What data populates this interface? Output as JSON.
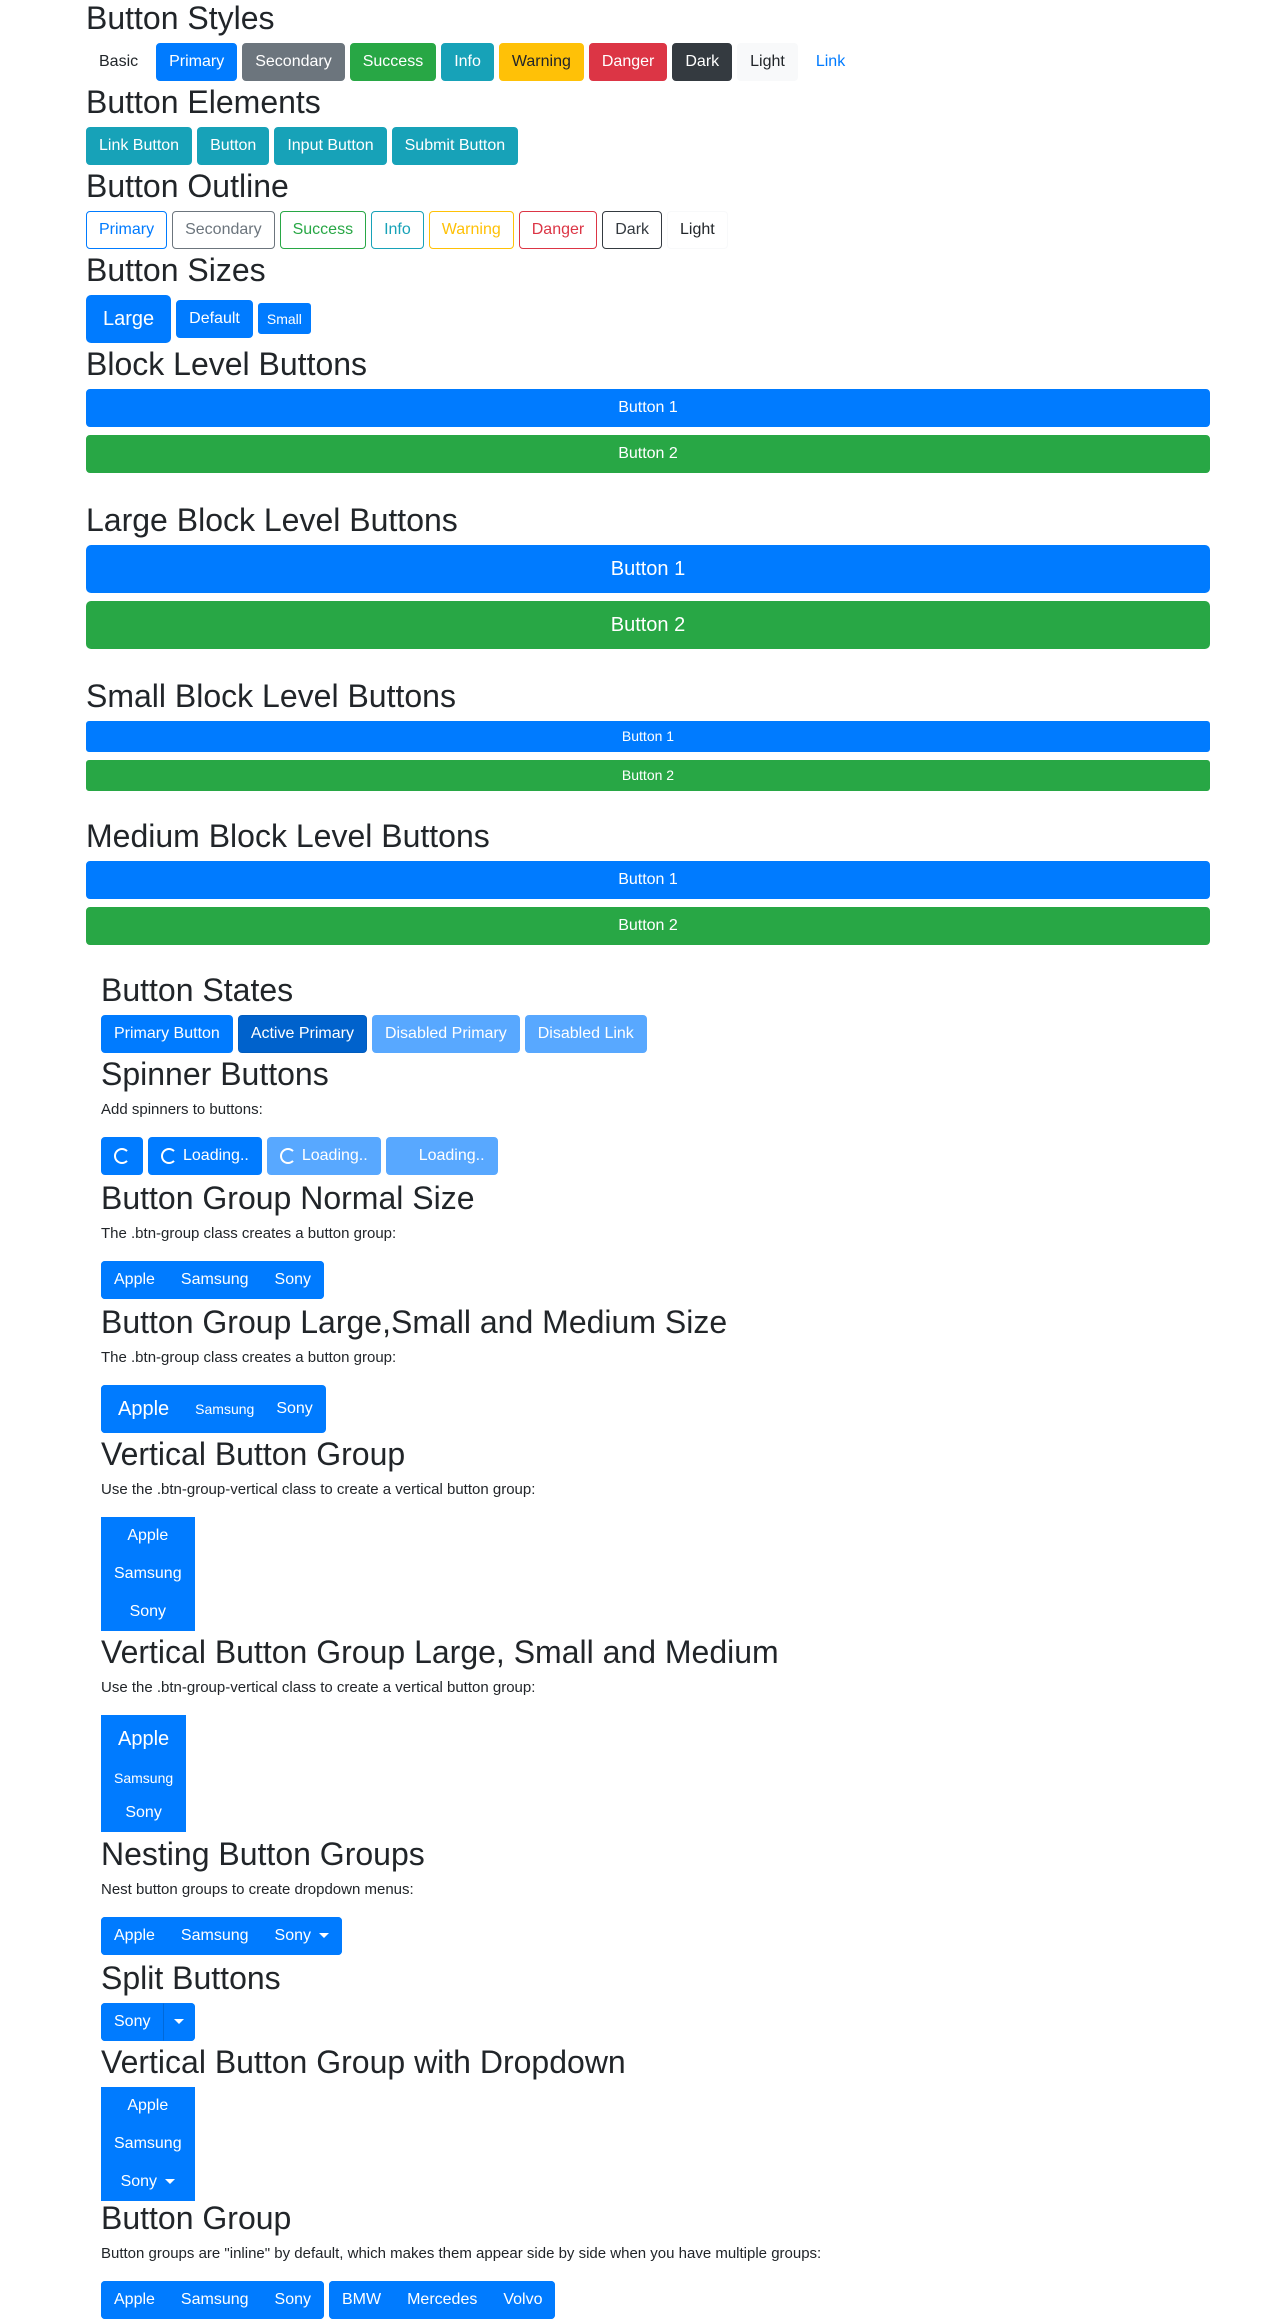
{
  "sections": {
    "styles": {
      "title": "Button Styles",
      "buttons": [
        "Basic",
        "Primary",
        "Secondary",
        "Success",
        "Info",
        "Warning",
        "Danger",
        "Dark",
        "Light",
        "Link"
      ]
    },
    "elements": {
      "title": "Button Elements",
      "buttons": [
        "Link Button",
        "Button",
        "Input Button",
        "Submit Button"
      ]
    },
    "outline": {
      "title": "Button Outline",
      "buttons": [
        "Primary",
        "Secondary",
        "Success",
        "Info",
        "Warning",
        "Danger",
        "Dark",
        "Light"
      ]
    },
    "sizes": {
      "title": "Button Sizes",
      "buttons": [
        "Large",
        "Default",
        "Small"
      ]
    },
    "block": {
      "title": "Block Level Buttons",
      "buttons": [
        "Button 1",
        "Button 2"
      ]
    },
    "block_large": {
      "title": "Large Block Level Buttons",
      "buttons": [
        "Button 1",
        "Button 2"
      ]
    },
    "block_small": {
      "title": "Small Block Level Buttons",
      "buttons": [
        "Button 1",
        "Button 2"
      ]
    },
    "block_medium": {
      "title": "Medium Block Level Buttons",
      "buttons": [
        "Button 1",
        "Button 2"
      ]
    },
    "states": {
      "title": "Button States",
      "buttons": [
        "Primary Button",
        "Active Primary",
        "Disabled Primary",
        "Disabled Link"
      ]
    },
    "spinner": {
      "title": "Spinner Buttons",
      "desc": "Add spinners to buttons:",
      "loading": "Loading.."
    },
    "group_normal": {
      "title": "Button Group Normal Size",
      "desc": "The .btn-group class creates a button group:",
      "buttons": [
        "Apple",
        "Samsung",
        "Sony"
      ]
    },
    "group_sizes": {
      "title": "Button Group Large,Small and Medium Size",
      "desc": "The .btn-group class creates a button group:",
      "buttons": [
        "Apple",
        "Samsung",
        "Sony"
      ]
    },
    "vertical": {
      "title": "Vertical Button Group",
      "desc": "Use the .btn-group-vertical class to create a vertical button group:",
      "buttons": [
        "Apple",
        "Samsung",
        "Sony"
      ]
    },
    "vertical_sizes": {
      "title": "Vertical Button Group Large, Small and Medium",
      "desc": "Use the .btn-group-vertical class to create a vertical button group:",
      "buttons": [
        "Apple",
        "Samsung",
        "Sony"
      ]
    },
    "nesting": {
      "title": "Nesting Button Groups",
      "desc": "Nest button groups to create dropdown menus:",
      "buttons": [
        "Apple",
        "Samsung",
        "Sony"
      ]
    },
    "split": {
      "title": "Split Buttons",
      "button": "Sony"
    },
    "vertical_dropdown": {
      "title": "Vertical Button Group with Dropdown",
      "buttons": [
        "Apple",
        "Samsung",
        "Sony"
      ]
    },
    "group_inline": {
      "title": "Button Group",
      "desc": "Button groups are \"inline\" by default, which makes them appear side by side when you have multiple groups:",
      "group1": [
        "Apple",
        "Samsung",
        "Sony"
      ],
      "group2": [
        "BMW",
        "Mercedes",
        "Volvo"
      ]
    }
  },
  "colors": {
    "primary": "#007bff",
    "secondary": "#6c757d",
    "success": "#28a745",
    "info": "#17a2b8",
    "warning": "#ffc107",
    "danger": "#dc3545",
    "dark": "#343a40",
    "light": "#f8f9fa"
  }
}
